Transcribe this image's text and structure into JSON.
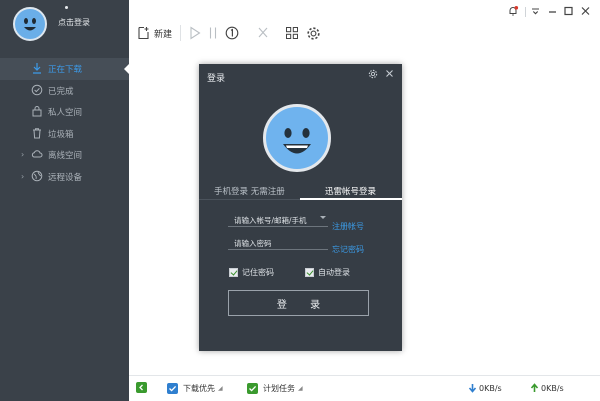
{
  "sidebar": {
    "profile": {
      "login_text": "点击登录"
    },
    "items": [
      {
        "label": "正在下载",
        "icon": "download-icon",
        "active": true,
        "expandable": false
      },
      {
        "label": "已完成",
        "icon": "check-circle-icon",
        "active": false,
        "expandable": false
      },
      {
        "label": "私人空间",
        "icon": "lock-icon",
        "active": false,
        "expandable": false
      },
      {
        "label": "垃圾箱",
        "icon": "trash-icon",
        "active": false,
        "expandable": false
      },
      {
        "label": "离线空间",
        "icon": "cloud-icon",
        "active": false,
        "expandable": true
      },
      {
        "label": "远程设备",
        "icon": "globe-icon",
        "active": false,
        "expandable": true
      }
    ]
  },
  "toolbar": {
    "new_label": "新建",
    "icons": [
      "new-file-icon",
      "play-icon",
      "pause-icon",
      "speed-limit-icon",
      "delete-icon",
      "grid-icon",
      "settings-icon"
    ]
  },
  "window_controls": [
    "notification-icon",
    "menu-icon",
    "minimize-icon",
    "maximize-icon",
    "close-icon"
  ],
  "dialog": {
    "title": "登录",
    "tabs": [
      {
        "label": "手机登录 无需注册",
        "active": false
      },
      {
        "label": "迅雷帐号登录",
        "active": true
      }
    ],
    "account_placeholder": "请输入帐号/邮箱/手机",
    "password_placeholder": "请输入密码",
    "register_link": "注册帐号",
    "forgot_link": "忘记密码",
    "remember_label": "记住密码",
    "remember_checked": true,
    "auto_login_label": "自动登录",
    "auto_login_checked": true,
    "login_button": "登 录"
  },
  "bottombar": {
    "download_priority": "下载优先",
    "scheduled_task": "计划任务",
    "download_speed": "0KB/s",
    "upload_speed": "0KB/s"
  },
  "colors": {
    "sidebar_bg": "#3a4149",
    "dialog_bg": "#363d45",
    "accent_blue": "#3c9ae8",
    "avatar_blue": "#6fb3ee",
    "green": "#3a9a2e"
  }
}
